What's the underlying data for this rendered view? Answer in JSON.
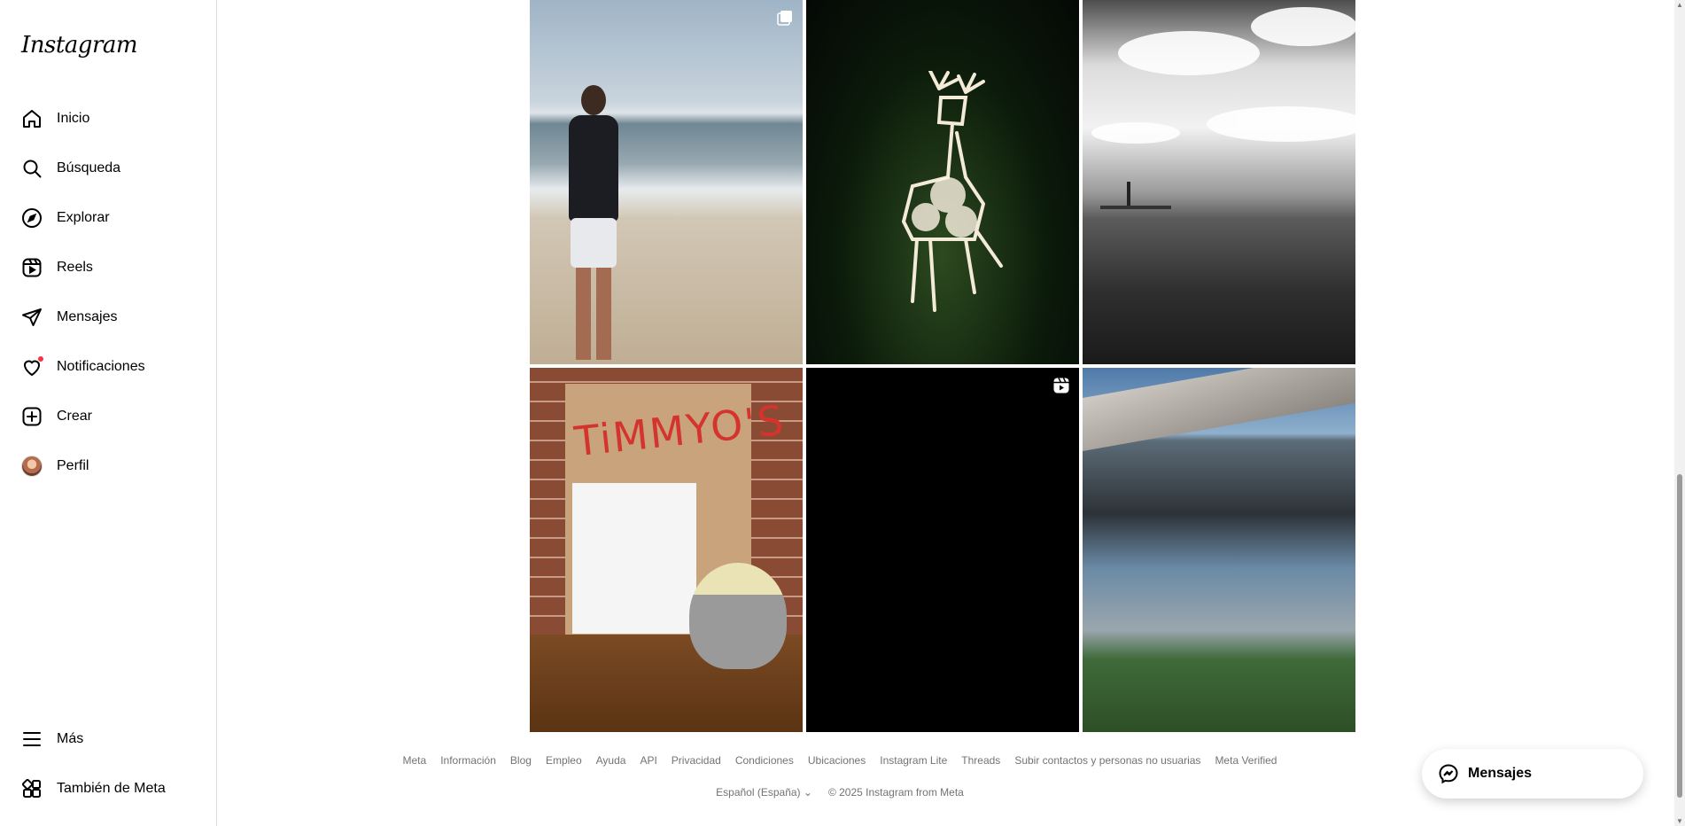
{
  "app": {
    "logo": "Instagram"
  },
  "sidebar": {
    "items": [
      {
        "label": "Inicio",
        "icon": "home-icon"
      },
      {
        "label": "Búsqueda",
        "icon": "search-icon"
      },
      {
        "label": "Explorar",
        "icon": "compass-icon"
      },
      {
        "label": "Reels",
        "icon": "reels-icon"
      },
      {
        "label": "Mensajes",
        "icon": "send-icon"
      },
      {
        "label": "Notificaciones",
        "icon": "heart-icon",
        "has_dot": true
      },
      {
        "label": "Crear",
        "icon": "plus-square-icon"
      },
      {
        "label": "Perfil",
        "icon": "avatar"
      }
    ],
    "bottom": [
      {
        "label": "Más",
        "icon": "menu-icon"
      },
      {
        "label": "También de Meta",
        "icon": "grid-icon"
      }
    ]
  },
  "grid": {
    "posts": [
      {
        "kind": "photo",
        "subject": "man on beach",
        "badge": "carousel-icon"
      },
      {
        "kind": "photo",
        "subject": "lit reindeer"
      },
      {
        "kind": "photo",
        "subject": "black and white sea"
      },
      {
        "kind": "photo",
        "subject": "drawing with cockatiel",
        "sign_text": "TiMMYO'S"
      },
      {
        "kind": "reel",
        "subject": "black video",
        "badge": "reels-icon"
      },
      {
        "kind": "photo",
        "subject": "modern house at dusk"
      }
    ]
  },
  "footer": {
    "links": [
      "Meta",
      "Información",
      "Blog",
      "Empleo",
      "Ayuda",
      "API",
      "Privacidad",
      "Condiciones",
      "Ubicaciones",
      "Instagram Lite",
      "Threads",
      "Subir contactos y personas no usuarias",
      "Meta Verified"
    ],
    "language": "Español (España)",
    "copyright": "© 2025 Instagram from Meta"
  },
  "messages_pill": {
    "label": "Mensajes",
    "icon": "messenger-icon"
  },
  "colors": {
    "notification_dot": "#ff3040",
    "text_muted": "#737373",
    "border": "#dbdbdb"
  }
}
